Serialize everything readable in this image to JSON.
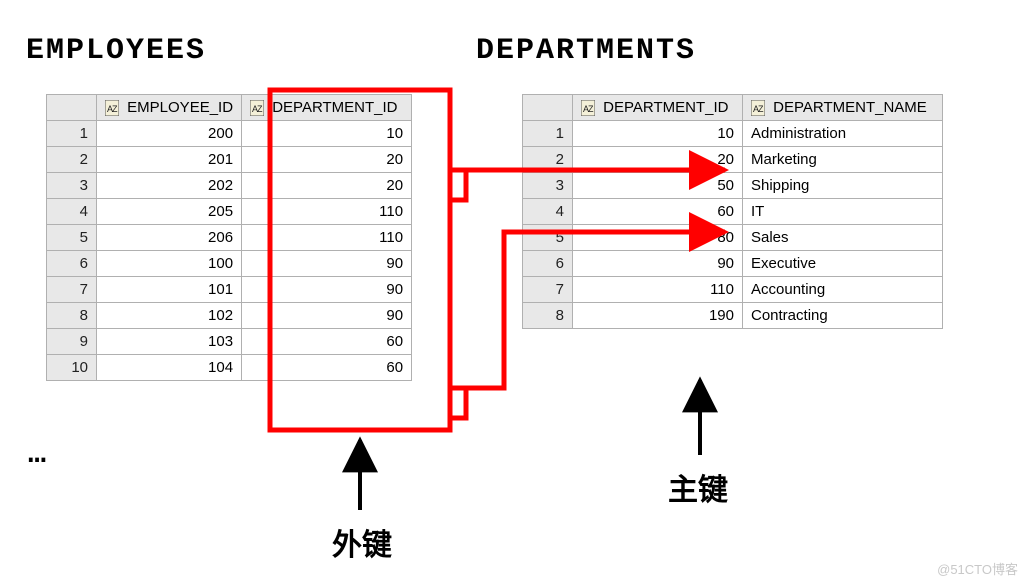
{
  "titles": {
    "employees": "EMPLOYEES",
    "departments": "DEPARTMENTS"
  },
  "employees": {
    "columns": {
      "employee_id": "EMPLOYEE_ID",
      "department_id": "DEPARTMENT_ID"
    },
    "rows": [
      {
        "n": "1",
        "employee_id": "200",
        "department_id": "10"
      },
      {
        "n": "2",
        "employee_id": "201",
        "department_id": "20"
      },
      {
        "n": "3",
        "employee_id": "202",
        "department_id": "20"
      },
      {
        "n": "4",
        "employee_id": "205",
        "department_id": "110"
      },
      {
        "n": "5",
        "employee_id": "206",
        "department_id": "110"
      },
      {
        "n": "6",
        "employee_id": "100",
        "department_id": "90"
      },
      {
        "n": "7",
        "employee_id": "101",
        "department_id": "90"
      },
      {
        "n": "8",
        "employee_id": "102",
        "department_id": "90"
      },
      {
        "n": "9",
        "employee_id": "103",
        "department_id": "60"
      },
      {
        "n": "10",
        "employee_id": "104",
        "department_id": "60"
      }
    ]
  },
  "departments": {
    "columns": {
      "department_id": "DEPARTMENT_ID",
      "department_name": "DEPARTMENT_NAME"
    },
    "rows": [
      {
        "n": "1",
        "department_id": "10",
        "department_name": "Administration"
      },
      {
        "n": "2",
        "department_id": "20",
        "department_name": "Marketing"
      },
      {
        "n": "3",
        "department_id": "50",
        "department_name": "Shipping"
      },
      {
        "n": "4",
        "department_id": "60",
        "department_name": "IT"
      },
      {
        "n": "5",
        "department_id": "80",
        "department_name": "Sales"
      },
      {
        "n": "6",
        "department_id": "90",
        "department_name": "Executive"
      },
      {
        "n": "7",
        "department_id": "110",
        "department_name": "Accounting"
      },
      {
        "n": "8",
        "department_id": "190",
        "department_name": "Contracting"
      }
    ]
  },
  "labels": {
    "foreign_key": "外键",
    "primary_key": "主键",
    "ellipsis": "…"
  },
  "watermark": "@51CTO博客",
  "colors": {
    "highlight": "#ff0000",
    "arrow_black": "#000000"
  },
  "chart_data": {
    "type": "table",
    "relationship": "foreign_key",
    "from": {
      "table": "EMPLOYEES",
      "column": "DEPARTMENT_ID",
      "role": "外键"
    },
    "to": {
      "table": "DEPARTMENTS",
      "column": "DEPARTMENT_ID",
      "role": "主键"
    },
    "example_links": [
      {
        "from_values": [
          "20",
          "20"
        ],
        "to_value": "20",
        "to_name": "Marketing"
      },
      {
        "from_values": [
          "60",
          "60"
        ],
        "to_value": "60",
        "to_name": "IT"
      }
    ]
  }
}
